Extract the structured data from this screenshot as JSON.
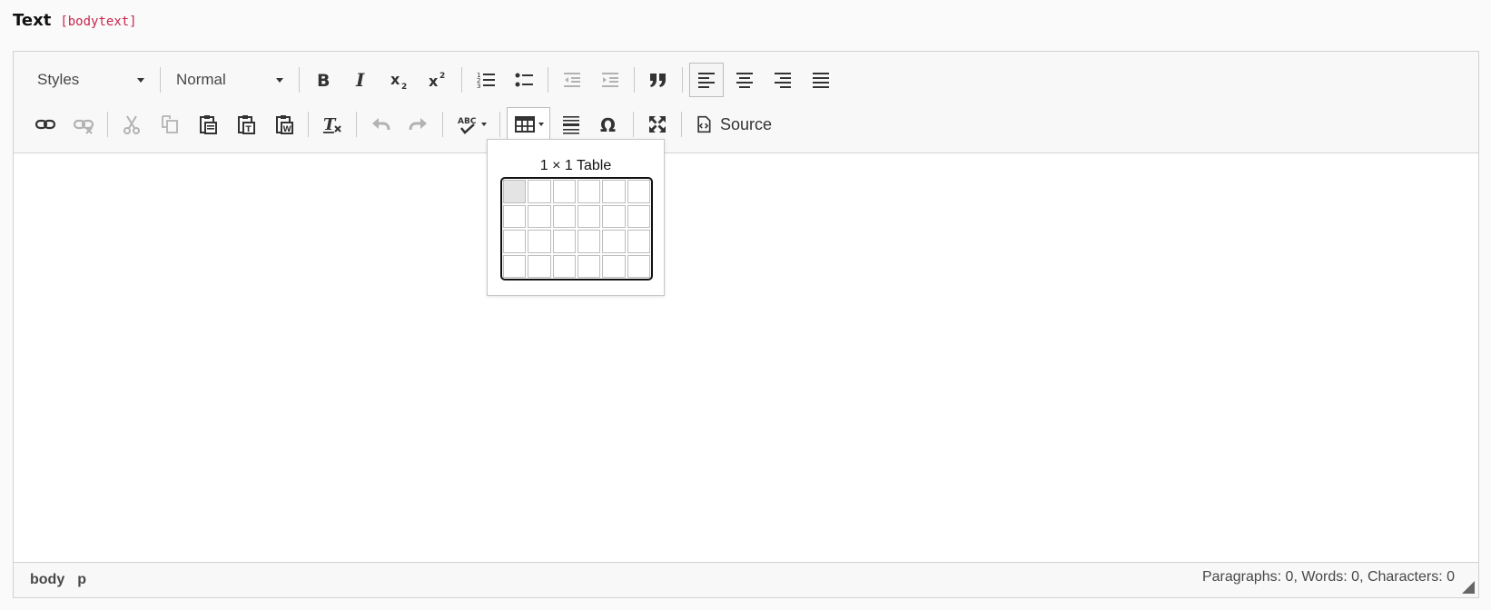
{
  "field": {
    "title": "Text",
    "code": "[bodytext]"
  },
  "toolbar": {
    "styles_combo": "Styles",
    "format_combo": "Normal",
    "source_label": "Source"
  },
  "table_picker": {
    "caption": "1 × 1 Table",
    "columns": 6,
    "rows": 4,
    "selected": "1 × 1"
  },
  "statusbar": {
    "path": [
      "body",
      "p"
    ],
    "counts": "Paragraphs: 0, Words: 0, Characters: 0"
  },
  "colors": {
    "code_text": "#c7254e",
    "border": "#d1d1d1",
    "toolbar_bg": "#f8f8f8"
  }
}
